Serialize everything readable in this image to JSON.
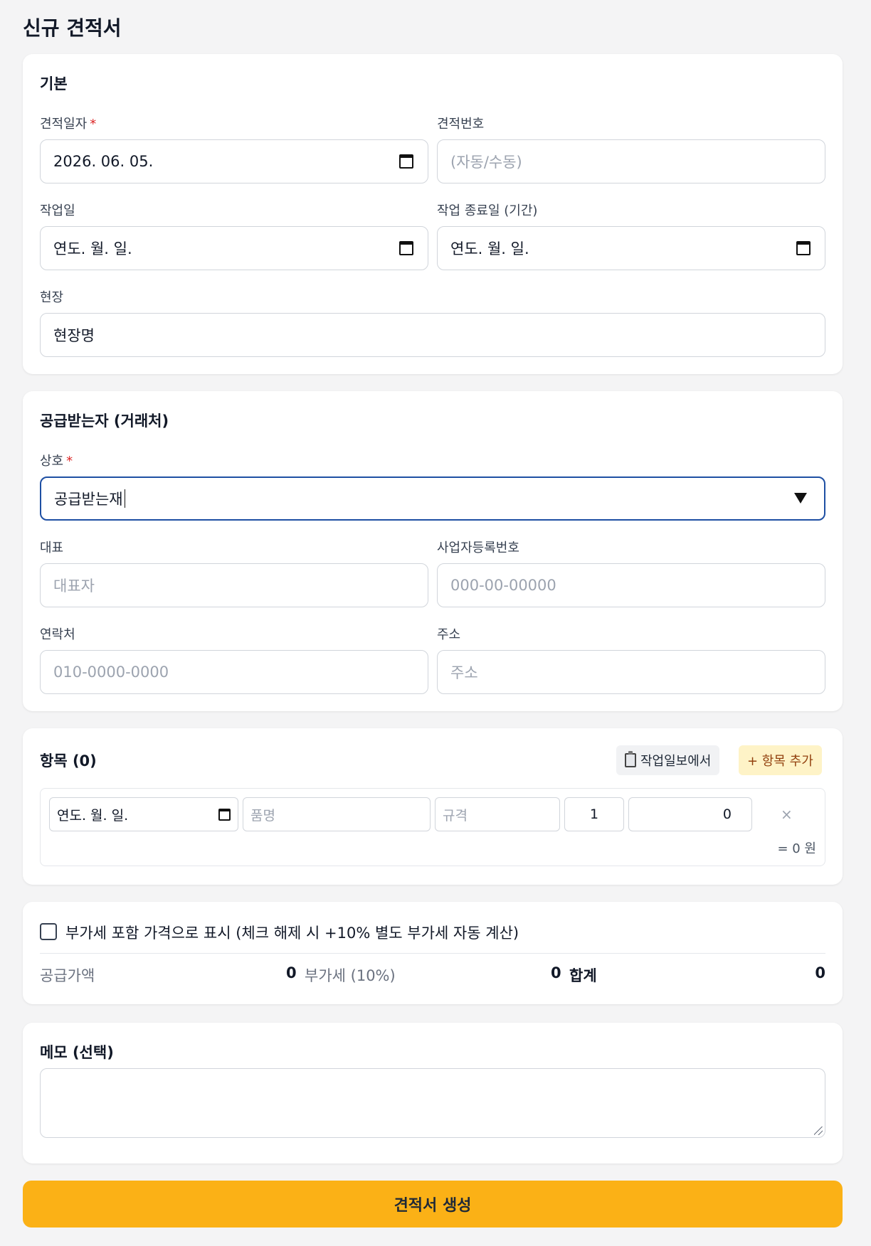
{
  "page": {
    "title": "신규 견적서"
  },
  "basic": {
    "title": "기본",
    "quote_date_label": "견적일자",
    "required_mark": "*",
    "quote_date_value": "2026. 06. 05.",
    "quote_no_label": "견적번호",
    "quote_no_placeholder": "(자동/수동)",
    "work_date_label": "작업일",
    "work_date_value": "연도. 월. 일.",
    "work_end_label": "작업 종료일 (기간)",
    "work_end_value": "연도. 월. 일.",
    "site_label": "현장",
    "site_value": "현장명"
  },
  "customer": {
    "title": "공급받는자 (거래처)",
    "company_label": "상호",
    "required_mark": "*",
    "company_value": "공급받는재",
    "ceo_label": "대표",
    "ceo_placeholder": "대표자",
    "bizno_label": "사업자등록번호",
    "bizno_placeholder": "000-00-00000",
    "phone_label": "연락처",
    "phone_placeholder": "010-0000-0000",
    "address_label": "주소",
    "address_placeholder": "주소"
  },
  "items": {
    "title": "항목 (0)",
    "from_report_label": "작업일보에서",
    "add_label": "+ 항목 추가",
    "row": {
      "date_value": "연도. 월. 일.",
      "name_placeholder": "품명",
      "spec_placeholder": "규격",
      "qty_value": "1",
      "price_value": "0",
      "remove_label": "×",
      "total_label": "= 0 원"
    }
  },
  "summary": {
    "vat_checkbox_label": "부가세 포함 가격으로 표시 (체크 해제 시 +10% 별도 부가세 자동 계산)",
    "supply_label": "공급가액",
    "supply_value": "0",
    "vat_label": "부가세 (10%)",
    "vat_value": "0",
    "total_label": "합계",
    "total_value": "0"
  },
  "memo": {
    "title": "메모 (선택)"
  },
  "submit": {
    "label": "견적서 생성"
  }
}
